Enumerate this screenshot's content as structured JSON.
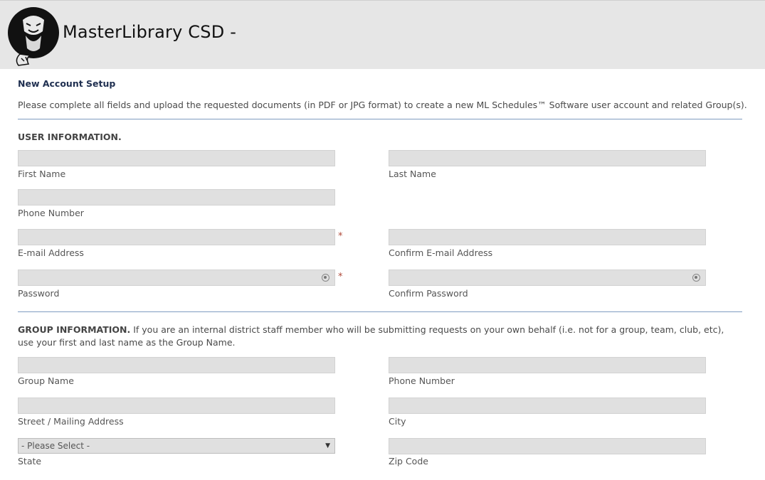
{
  "header": {
    "title": "MasterLibrary CSD -"
  },
  "form": {
    "heading": "New Account Setup",
    "intro": "Please complete all fields and upload the requested documents (in PDF or JPG format) to create a new ML Schedules™ Software user account and related Group(s).",
    "user_section": {
      "title": "USER INFORMATION.",
      "first_name": "First Name",
      "last_name": "Last Name",
      "phone": "Phone Number",
      "email": "E-mail Address",
      "confirm_email": "Confirm E-mail Address",
      "password": "Password",
      "confirm_password": "Confirm Password",
      "required_mark": "*"
    },
    "group_section": {
      "title": "GROUP INFORMATION.",
      "description": " If you are an internal district staff member who will be submitting requests on your own behalf (i.e. not for a group, team, club, etc), use your first and last name as the Group Name.",
      "group_name": "Group Name",
      "phone": "Phone Number",
      "street": "Street / Mailing Address",
      "city": "City",
      "state": "State",
      "state_selected": "- Please Select -",
      "zip": "Zip Code"
    }
  }
}
